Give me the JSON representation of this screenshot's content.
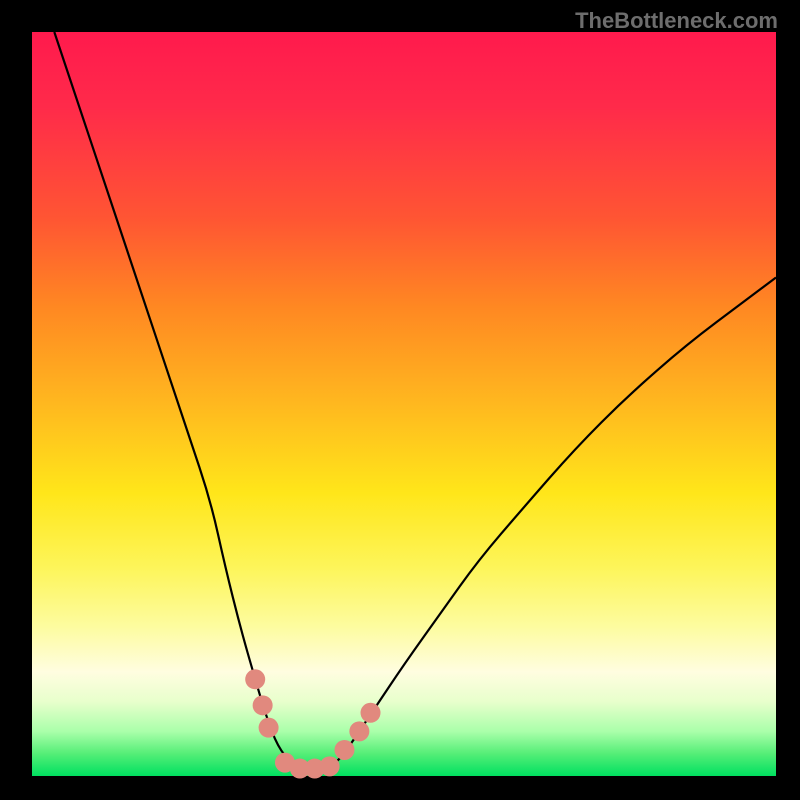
{
  "watermark_text": "TheBottleneck.com",
  "chart_data": {
    "type": "line",
    "title": "",
    "xlabel": "",
    "ylabel": "",
    "xlim": [
      0,
      100
    ],
    "ylim": [
      0,
      100
    ],
    "series": [
      {
        "name": "bottleneck-curve",
        "x": [
          3,
          6,
          9,
          12,
          15,
          18,
          21,
          24,
          26,
          28,
          30,
          31.5,
          33,
          35,
          37,
          39,
          41,
          43,
          46,
          50,
          55,
          60,
          66,
          73,
          80,
          88,
          96,
          100
        ],
        "y": [
          100,
          91,
          82,
          73,
          64,
          55,
          46,
          37,
          28,
          20,
          13,
          8,
          4,
          1.5,
          0.8,
          0.8,
          1.8,
          4.5,
          9,
          15,
          22,
          29,
          36,
          44,
          51,
          58,
          64,
          67
        ]
      }
    ],
    "markers": [
      {
        "x": 30.0,
        "y": 13.0
      },
      {
        "x": 31.0,
        "y": 9.5
      },
      {
        "x": 31.8,
        "y": 6.5
      },
      {
        "x": 34.0,
        "y": 1.8
      },
      {
        "x": 36.0,
        "y": 1.0
      },
      {
        "x": 38.0,
        "y": 1.0
      },
      {
        "x": 40.0,
        "y": 1.3
      },
      {
        "x": 42.0,
        "y": 3.5
      },
      {
        "x": 44.0,
        "y": 6.0
      },
      {
        "x": 45.5,
        "y": 8.5
      }
    ],
    "background_gradient": {
      "top": "#ff1a4d",
      "mid": "#ffe61a",
      "bottom": "#00e060"
    }
  }
}
